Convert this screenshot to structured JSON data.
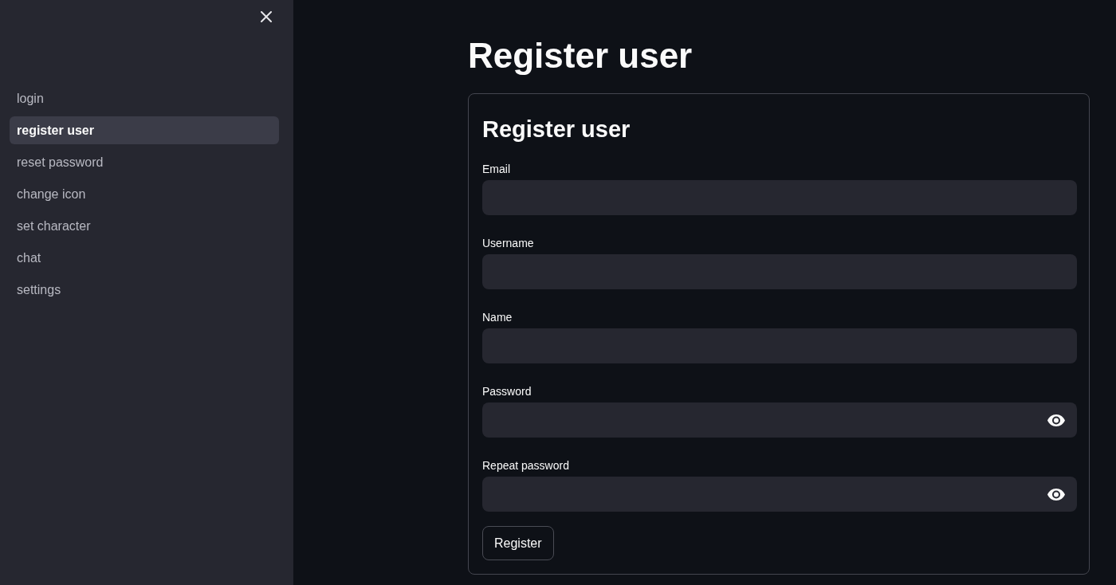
{
  "sidebar": {
    "items": [
      {
        "label": "login",
        "selected": false
      },
      {
        "label": "register user",
        "selected": true
      },
      {
        "label": "reset password",
        "selected": false
      },
      {
        "label": "change icon",
        "selected": false
      },
      {
        "label": "set character",
        "selected": false
      },
      {
        "label": "chat",
        "selected": false
      },
      {
        "label": "settings",
        "selected": false
      }
    ]
  },
  "page_title": "Register user",
  "form": {
    "title": "Register user",
    "fields": [
      {
        "label": "Email",
        "kind": "text"
      },
      {
        "label": "Username",
        "kind": "text"
      },
      {
        "label": "Name",
        "kind": "text"
      },
      {
        "label": "Password",
        "kind": "password"
      },
      {
        "label": "Repeat password",
        "kind": "password"
      }
    ],
    "submit_button": "Register"
  }
}
